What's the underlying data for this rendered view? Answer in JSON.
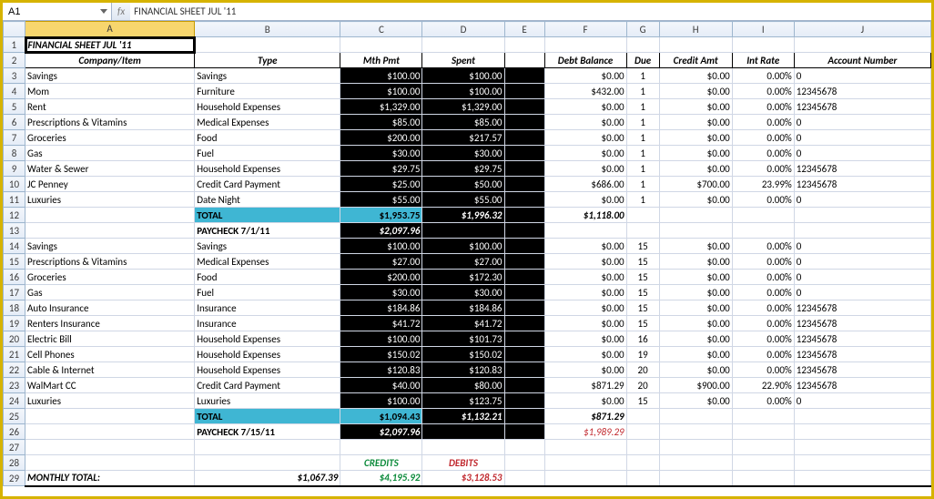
{
  "namebox": "A1",
  "formula_prefix": "fx",
  "formula_value": "FINANCIAL SHEET JUL '11",
  "columns": [
    "",
    "A",
    "B",
    "C",
    "D",
    "E",
    "F",
    "G",
    "H",
    "I",
    "J"
  ],
  "row_labels": [
    "1",
    "2",
    "3",
    "4",
    "5",
    "6",
    "7",
    "8",
    "9",
    "10",
    "11",
    "12",
    "13",
    "14",
    "15",
    "16",
    "17",
    "18",
    "19",
    "20",
    "21",
    "22",
    "23",
    "24",
    "25",
    "26",
    "27",
    "28",
    "29"
  ],
  "title": "FINANCIAL SHEET JUL '11",
  "headers": {
    "A": "Company/Item",
    "B": "Type",
    "C": "Mth Pmt",
    "D": "Spent",
    "E": "",
    "F": "Debt Balance",
    "G": "Due",
    "H": "Credit Amt",
    "I": "Int Rate",
    "J": "Account Number"
  },
  "rows": [
    {
      "a": "Savings",
      "b": "Savings",
      "c": "$100.00",
      "d": "$100.00",
      "f": "$0.00",
      "g": "1",
      "h": "$0.00",
      "i": "0.00%",
      "j": "0"
    },
    {
      "a": "Mom",
      "b": "Furniture",
      "c": "$100.00",
      "d": "$100.00",
      "f": "$432.00",
      "g": "1",
      "h": "$0.00",
      "i": "0.00%",
      "j": "12345678"
    },
    {
      "a": "Rent",
      "b": "Household Expenses",
      "c": "$1,329.00",
      "d": "$1,329.00",
      "f": "$0.00",
      "g": "1",
      "h": "$0.00",
      "i": "0.00%",
      "j": "12345678"
    },
    {
      "a": "Prescriptions & Vitamins",
      "b": "Medical Expenses",
      "c": "$85.00",
      "d": "$85.00",
      "f": "$0.00",
      "g": "1",
      "h": "$0.00",
      "i": "0.00%",
      "j": "0"
    },
    {
      "a": "Groceries",
      "b": "Food",
      "c": "$200.00",
      "d": "$217.57",
      "f": "$0.00",
      "g": "1",
      "h": "$0.00",
      "i": "0.00%",
      "j": "0"
    },
    {
      "a": "Gas",
      "b": "Fuel",
      "c": "$30.00",
      "d": "$30.00",
      "f": "$0.00",
      "g": "1",
      "h": "$0.00",
      "i": "0.00%",
      "j": "0"
    },
    {
      "a": "Water & Sewer",
      "b": "Household Expenses",
      "c": "$29.75",
      "d": "$29.75",
      "f": "$0.00",
      "g": "1",
      "h": "$0.00",
      "i": "0.00%",
      "j": "12345678"
    },
    {
      "a": "JC Penney",
      "b": "Credit Card Payment",
      "c": "$25.00",
      "d": "$50.00",
      "f": "$686.00",
      "g": "1",
      "h": "$700.00",
      "i": "23.99%",
      "j": "12345678"
    },
    {
      "a": "Luxuries",
      "b": "Date Night",
      "c": "$55.00",
      "d": "$55.00",
      "f": "$0.00",
      "g": "1",
      "h": "$0.00",
      "i": "0.00%",
      "j": "0"
    }
  ],
  "total1": {
    "b": "TOTAL",
    "c": "$1,953.75",
    "d": "$1,996.32",
    "f": "$1,118.00"
  },
  "paycheck1": {
    "b": "PAYCHECK 7/1/11",
    "c": "$2,097.96"
  },
  "rows2": [
    {
      "a": "Savings",
      "b": "Savings",
      "c": "$100.00",
      "d": "$100.00",
      "f": "$0.00",
      "g": "15",
      "h": "$0.00",
      "i": "0.00%",
      "j": "0"
    },
    {
      "a": "Prescriptions & Vitamins",
      "b": "Medical Expenses",
      "c": "$27.00",
      "d": "$27.00",
      "f": "$0.00",
      "g": "15",
      "h": "$0.00",
      "i": "0.00%",
      "j": "0"
    },
    {
      "a": "Groceries",
      "b": "Food",
      "c": "$200.00",
      "d": "$172.30",
      "f": "$0.00",
      "g": "15",
      "h": "$0.00",
      "i": "0.00%",
      "j": "0"
    },
    {
      "a": "Gas",
      "b": "Fuel",
      "c": "$30.00",
      "d": "$30.00",
      "f": "$0.00",
      "g": "15",
      "h": "$0.00",
      "i": "0.00%",
      "j": "0"
    },
    {
      "a": "Auto Insurance",
      "b": "Insurance",
      "c": "$184.86",
      "d": "$184.86",
      "f": "$0.00",
      "g": "15",
      "h": "$0.00",
      "i": "0.00%",
      "j": "12345678"
    },
    {
      "a": "Renters Insurance",
      "b": "Insurance",
      "c": "$41.72",
      "d": "$41.72",
      "f": "$0.00",
      "g": "15",
      "h": "$0.00",
      "i": "0.00%",
      "j": "12345678"
    },
    {
      "a": "Electric Bill",
      "b": "Household Expenses",
      "c": "$100.00",
      "d": "$101.73",
      "f": "$0.00",
      "g": "16",
      "h": "$0.00",
      "i": "0.00%",
      "j": "12345678"
    },
    {
      "a": "Cell Phones",
      "b": "Household Expenses",
      "c": "$150.02",
      "d": "$150.02",
      "f": "$0.00",
      "g": "19",
      "h": "$0.00",
      "i": "0.00%",
      "j": "12345678"
    },
    {
      "a": "Cable & Internet",
      "b": "Household Expenses",
      "c": "$120.83",
      "d": "$120.83",
      "f": "$0.00",
      "g": "20",
      "h": "$0.00",
      "i": "0.00%",
      "j": "12345678"
    },
    {
      "a": "WalMart CC",
      "b": "Credit Card Payment",
      "c": "$40.00",
      "d": "$80.00",
      "f": "$871.29",
      "g": "20",
      "h": "$900.00",
      "i": "22.90%",
      "j": "12345678"
    },
    {
      "a": "Luxuries",
      "b": "Luxuries",
      "c": "$100.00",
      "d": "$123.75",
      "f": "$0.00",
      "g": "15",
      "h": "$0.00",
      "i": "0.00%",
      "j": "0"
    }
  ],
  "total2": {
    "b": "TOTAL",
    "c": "$1,094.43",
    "d": "$1,132.21",
    "f": "$871.29"
  },
  "paycheck2": {
    "b": "PAYCHECK 7/15/11",
    "c": "$2,097.96",
    "f": "$1,989.29"
  },
  "labels28": {
    "c": "CREDITS",
    "d": "DEBITS"
  },
  "monthly": {
    "a": "MONTHLY TOTAL:",
    "b": "$1,067.39",
    "c": "$4,195.92",
    "d": "$3,128.53"
  }
}
